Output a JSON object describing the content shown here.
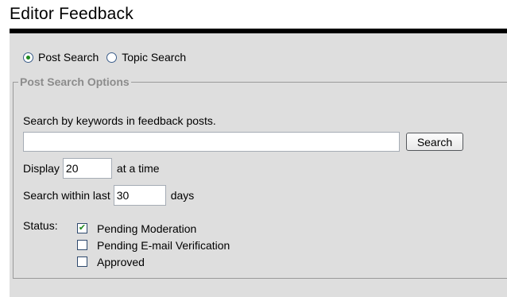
{
  "page": {
    "title": "Editor Feedback"
  },
  "search_mode": {
    "options": [
      {
        "label": "Post Search",
        "selected": true
      },
      {
        "label": "Topic Search",
        "selected": false
      }
    ]
  },
  "post_search_options": {
    "legend": "Post Search Options",
    "keywords_label": "Search by keywords in feedback posts.",
    "keywords_value": "",
    "search_button": "Search",
    "display_prefix": "Display",
    "display_value": "20",
    "display_suffix": "at a time",
    "within_prefix": "Search within last",
    "within_value": "30",
    "within_suffix": "days",
    "status_label": "Status:",
    "statuses": [
      {
        "label": "Pending Moderation",
        "checked": true
      },
      {
        "label": "Pending E-mail Verification",
        "checked": false
      },
      {
        "label": "Approved",
        "checked": false
      }
    ]
  },
  "colors": {
    "panel_background": "#dedede",
    "radio_dot": "#1e8a1e",
    "check_mark": "#1e8a1e",
    "legend_text": "#8c8c8c"
  }
}
